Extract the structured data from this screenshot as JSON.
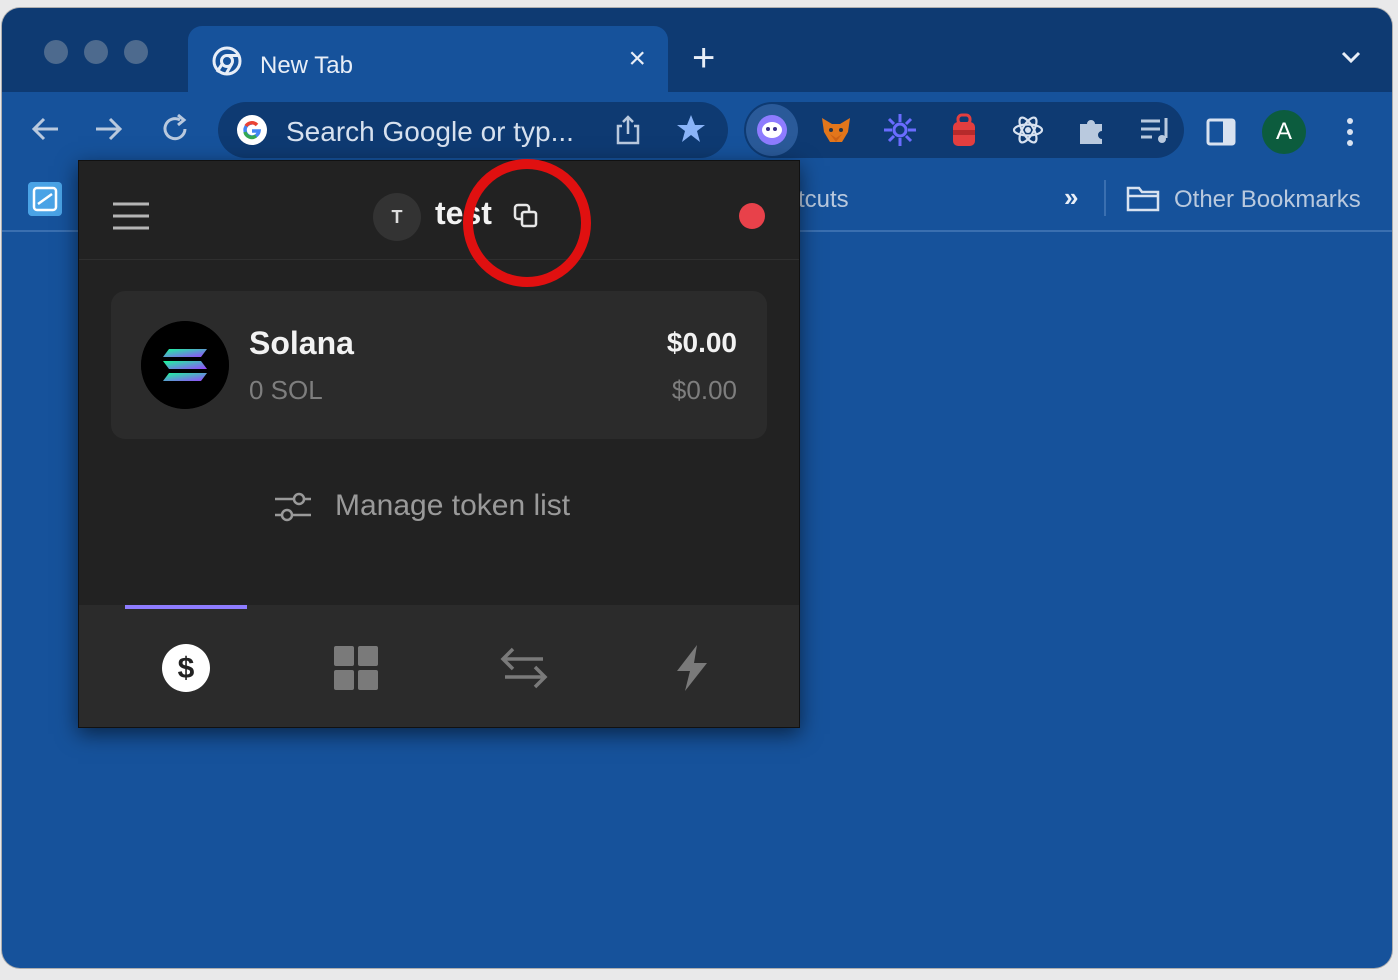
{
  "browser": {
    "tab": {
      "title": "New Tab",
      "close": "×"
    },
    "new_tab": "+",
    "omnibox": {
      "placeholder": "Search Google or typ..."
    },
    "profile_initial": "A",
    "bookmarks": {
      "shortcuts_fragment": "tcuts",
      "overflow": "»",
      "other": "Other Bookmarks"
    }
  },
  "wallet_popup": {
    "account": {
      "avatar_initial": "T",
      "name": "test"
    },
    "status_color": "#e8414a",
    "token": {
      "name": "Solana",
      "amount": "0 SOL",
      "value": "$0.00",
      "value_change": "$0.00"
    },
    "manage_label": "Manage token list",
    "accent": "#8e7cff",
    "bottom_tabs": [
      "balances-icon",
      "collectibles-icon",
      "swap-icon",
      "activity-icon"
    ]
  },
  "annotation": {
    "ring_color": "#e01010"
  }
}
